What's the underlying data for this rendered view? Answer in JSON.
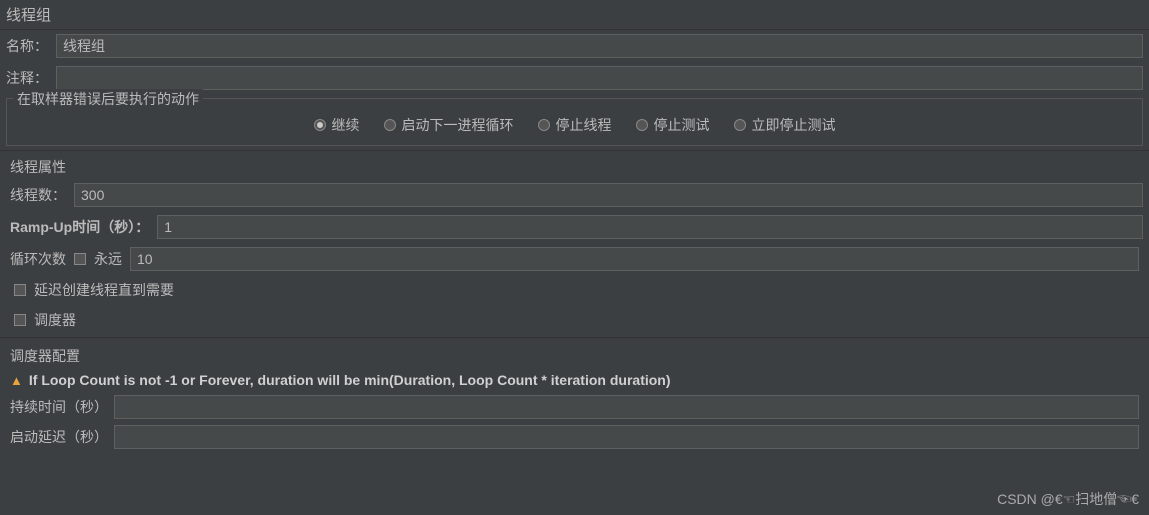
{
  "header": {
    "title": "线程组"
  },
  "fields": {
    "name_label": "名称：",
    "name_value": "线程组",
    "comment_label": "注释："
  },
  "error_action": {
    "legend": "在取样器错误后要执行的动作",
    "options": [
      {
        "label": "继续",
        "selected": true
      },
      {
        "label": "启动下一进程循环",
        "selected": false
      },
      {
        "label": "停止线程",
        "selected": false
      },
      {
        "label": "停止测试",
        "selected": false
      },
      {
        "label": "立即停止测试",
        "selected": false
      }
    ]
  },
  "thread_props": {
    "header": "线程属性",
    "threads_label": "线程数：",
    "threads_value": "300",
    "rampup_label": "Ramp-Up时间（秒）：",
    "rampup_value": "1",
    "loop_label": "循环次数",
    "forever_label": "永远",
    "loop_value": "10",
    "delay_create_label": "延迟创建线程直到需要",
    "scheduler_label": "调度器"
  },
  "scheduler_config": {
    "header": "调度器配置",
    "warning": "If Loop Count is not -1 or Forever, duration will be min(Duration, Loop Count * iteration duration)",
    "duration_label": "持续时间（秒）",
    "startup_delay_label": "启动延迟（秒）"
  },
  "watermark": "CSDN @€☜扫地僧☜€"
}
